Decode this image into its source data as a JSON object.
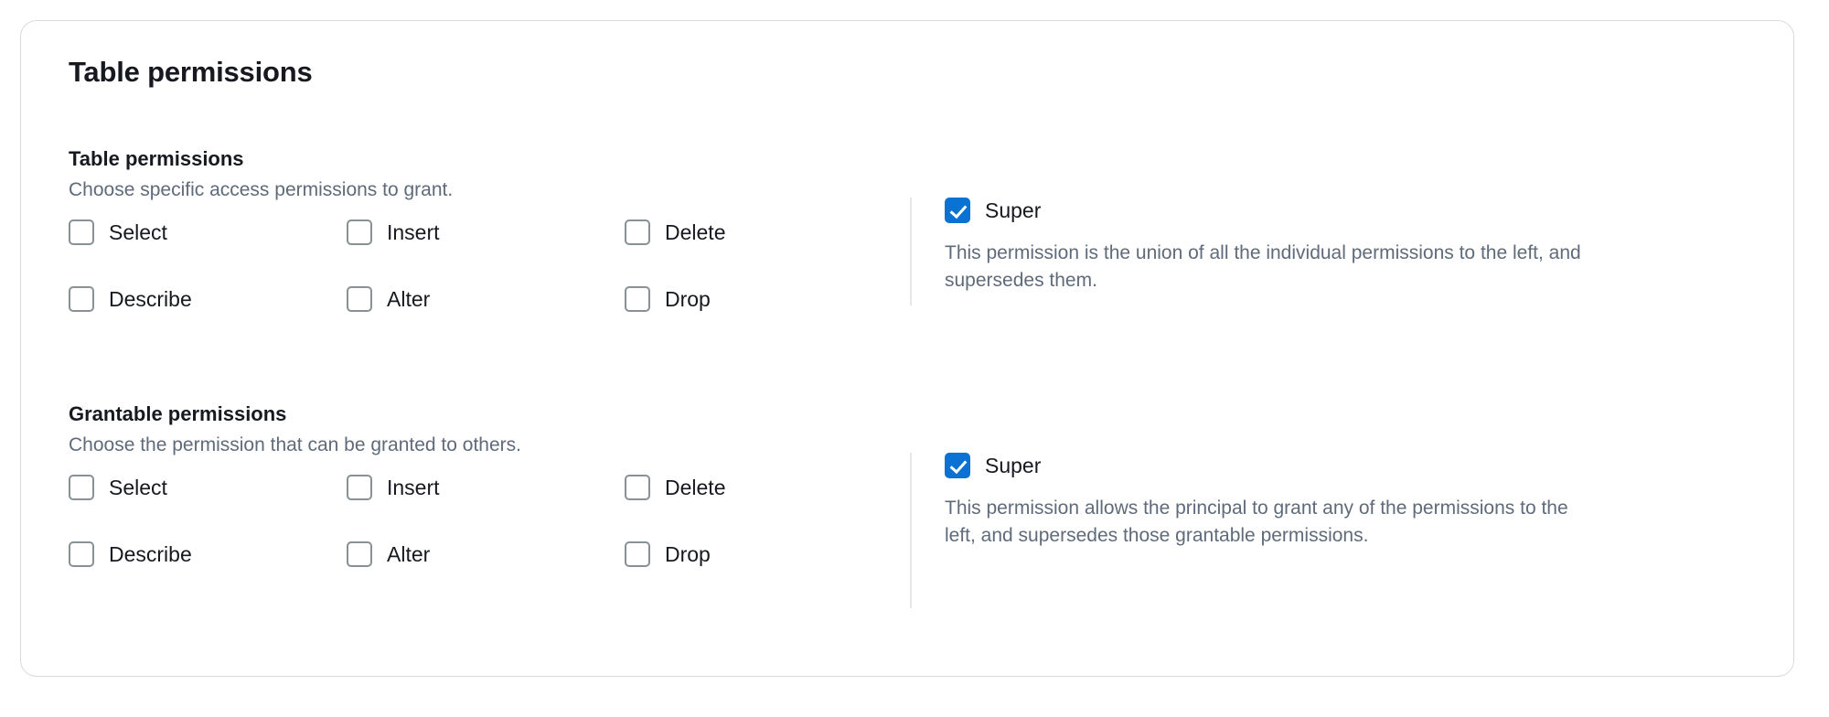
{
  "card": {
    "title": "Table permissions"
  },
  "sections": [
    {
      "heading": "Table permissions",
      "subtitle": "Choose specific access permissions to grant.",
      "checkboxes": [
        {
          "label": "Select",
          "checked": false
        },
        {
          "label": "Insert",
          "checked": false
        },
        {
          "label": "Delete",
          "checked": false
        },
        {
          "label": "Describe",
          "checked": false
        },
        {
          "label": "Alter",
          "checked": false
        },
        {
          "label": "Drop",
          "checked": false
        }
      ],
      "super": {
        "label": "Super",
        "checked": true,
        "description": "This permission is the union of all the individual permissions to the left, and supersedes them."
      }
    },
    {
      "heading": "Grantable permissions",
      "subtitle": "Choose the permission that can be granted to others.",
      "checkboxes": [
        {
          "label": "Select",
          "checked": false
        },
        {
          "label": "Insert",
          "checked": false
        },
        {
          "label": "Delete",
          "checked": false
        },
        {
          "label": "Describe",
          "checked": false
        },
        {
          "label": "Alter",
          "checked": false
        },
        {
          "label": "Drop",
          "checked": false
        }
      ],
      "super": {
        "label": "Super",
        "checked": true,
        "description": "This permission allows the principal to grant any of the permissions to the left, and supersedes those grantable permissions."
      }
    }
  ],
  "colors": {
    "accent": "#0972d3",
    "text": "#16191f",
    "muted": "#5f6b7a",
    "border": "#d5dbdb",
    "checkbox_border": "#879196",
    "divider": "#e4e6e8"
  }
}
